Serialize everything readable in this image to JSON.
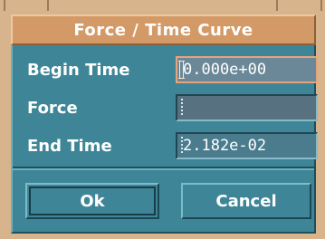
{
  "dialog": {
    "title": "Force / Time Curve",
    "fields": [
      {
        "label": "Begin Time",
        "value": "0.000e+00"
      },
      {
        "label": "Force",
        "value": ""
      },
      {
        "label": "End Time",
        "value": "2.182e-02"
      }
    ],
    "ok_label": "Ok",
    "cancel_label": "Cancel"
  },
  "colors": {
    "titlebar": "#d39a67",
    "panel": "#3e8597",
    "active_border": "#e9a37a",
    "frame": "#d8b48c"
  }
}
